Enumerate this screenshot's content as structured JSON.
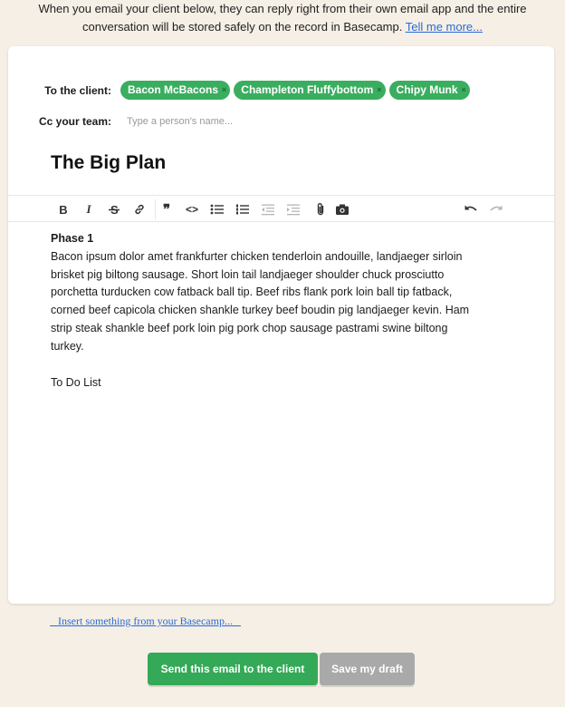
{
  "intro": {
    "line1": "When you email your client below, they can reply right from their own email app and the entire",
    "line2": "conversation will be stored safely on the record in Basecamp.",
    "link": "Tell me more..."
  },
  "to_field": {
    "label": "To the client:",
    "chips": [
      {
        "name": "Bacon McBacons",
        "remove": "×"
      },
      {
        "name": "Champleton Fluffybottom",
        "remove": "×"
      },
      {
        "name": "Chipy Munk",
        "remove": "×"
      }
    ]
  },
  "cc_field": {
    "label": "Cc your team:",
    "placeholder": "Type a person's name..."
  },
  "subject": "The Big Plan",
  "toolbar": {
    "icons": [
      "bold-icon",
      "italic-icon",
      "strikethrough-icon",
      "link-icon",
      "quote-icon",
      "code-icon",
      "bullet-list-icon",
      "numbered-list-icon",
      "outdent-icon",
      "indent-icon",
      "attachment-icon",
      "camera-icon",
      "undo-icon",
      "redo-icon"
    ]
  },
  "body": {
    "heading": "Phase 1",
    "lines": [
      "Bacon ipsum dolor amet frankfurter chicken tenderloin andouille, landjaeger sirloin",
      "brisket pig biltong sausage. Short loin tail landjaeger shoulder chuck prosciutto",
      "porchetta turducken cow fatback ball tip. Beef ribs flank pork loin ball tip fatback,",
      "corned beef capicola chicken shankle turkey beef boudin pig landjaeger kevin. Ham",
      "strip steak shankle beef pork loin pig pork chop sausage pastrami swine biltong",
      "turkey."
    ],
    "todo": "To Do List"
  },
  "insert_link": "   Insert something from your Basecamp...   ",
  "buttons": {
    "send": "Send this email to the client",
    "draft": "Save my draft"
  },
  "colors": {
    "background": "#f5efe5",
    "chip": "#3aae5f",
    "send_button": "#34a957",
    "draft_button": "#a9a9a9",
    "link": "#2a6bd6"
  }
}
